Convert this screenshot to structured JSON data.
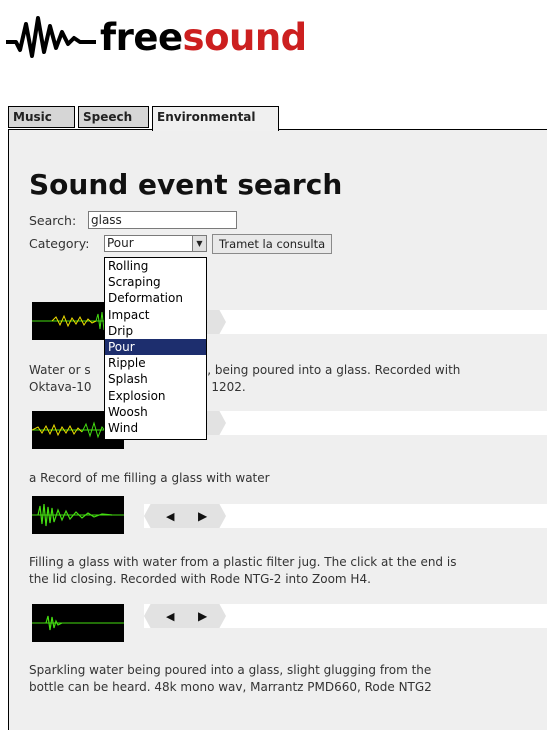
{
  "logo": {
    "part1": "free",
    "part2": "sound",
    "icon": "waveform-icon"
  },
  "tabs": [
    {
      "label": "Music"
    },
    {
      "label": "Speech"
    },
    {
      "label": "Environmental"
    }
  ],
  "title": "Sound event search",
  "search": {
    "label": "Search:",
    "value": "glass"
  },
  "category": {
    "label": "Category:",
    "selected": "Pour"
  },
  "submit_label": "Tramet la consulta",
  "dropdown_options": [
    "Rolling",
    "Scraping",
    "Deformation",
    "Impact",
    "Drip",
    "Pour",
    "Ripple",
    "Splash",
    "Explosion",
    "Woosh",
    "Wind"
  ],
  "results": [
    {
      "desc_line1": "Water or s",
      "desc_line1b": "uid, being poured into a glass. Recorded with",
      "desc_line2": "Oktava-10",
      "desc_line2b": "UB 1202."
    },
    {
      "desc": "a Record of me filling a glass with water"
    },
    {
      "desc_line1": "Filling a glass with water from a plastic filter jug. The click at the end is",
      "desc_line2": "the lid closing. Recorded with Rode NTG-2 into Zoom H4."
    },
    {
      "desc_line1": "Sparkling water being poured into a glass, slight glugging from the",
      "desc_line2": "bottle can be heard. 48k mono wav, Marrantz PMD660, Rode NTG2"
    }
  ],
  "colors": {
    "accent": "#cc1f1f",
    "selection": "#1d2e6e",
    "waveform": "#44dd11",
    "waveform_highlight": "#eedd00"
  }
}
